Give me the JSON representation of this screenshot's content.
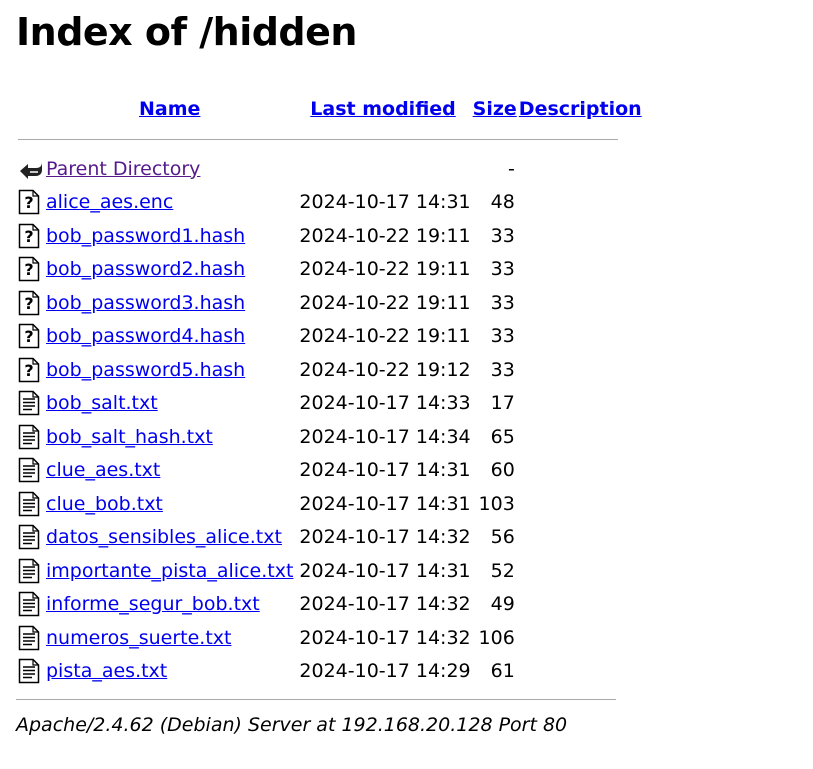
{
  "title": "Index of /hidden",
  "columns": {
    "name": "Name",
    "last_modified": "Last modified",
    "size": "Size",
    "description": "Description"
  },
  "parent": {
    "name": "Parent Directory",
    "size": "-",
    "icon": "back-icon"
  },
  "files": [
    {
      "name": "alice_aes.enc",
      "modified": "2024-10-17 14:31",
      "size": "48",
      "icon": "unknown-file-icon"
    },
    {
      "name": "bob_password1.hash",
      "modified": "2024-10-22 19:11",
      "size": "33",
      "icon": "unknown-file-icon"
    },
    {
      "name": "bob_password2.hash",
      "modified": "2024-10-22 19:11",
      "size": "33",
      "icon": "unknown-file-icon"
    },
    {
      "name": "bob_password3.hash",
      "modified": "2024-10-22 19:11",
      "size": "33",
      "icon": "unknown-file-icon"
    },
    {
      "name": "bob_password4.hash",
      "modified": "2024-10-22 19:11",
      "size": "33",
      "icon": "unknown-file-icon"
    },
    {
      "name": "bob_password5.hash",
      "modified": "2024-10-22 19:12",
      "size": "33",
      "icon": "unknown-file-icon"
    },
    {
      "name": "bob_salt.txt",
      "modified": "2024-10-17 14:33",
      "size": "17",
      "icon": "text-file-icon"
    },
    {
      "name": "bob_salt_hash.txt",
      "modified": "2024-10-17 14:34",
      "size": "65",
      "icon": "text-file-icon"
    },
    {
      "name": "clue_aes.txt",
      "modified": "2024-10-17 14:31",
      "size": "60",
      "icon": "text-file-icon"
    },
    {
      "name": "clue_bob.txt",
      "modified": "2024-10-17 14:31",
      "size": "103",
      "icon": "text-file-icon"
    },
    {
      "name": "datos_sensibles_alice.txt",
      "modified": "2024-10-17 14:32",
      "size": "56",
      "icon": "text-file-icon"
    },
    {
      "name": "importante_pista_alice.txt",
      "modified": "2024-10-17 14:31",
      "size": "52",
      "icon": "text-file-icon"
    },
    {
      "name": "informe_segur_bob.txt",
      "modified": "2024-10-17 14:32",
      "size": "49",
      "icon": "text-file-icon"
    },
    {
      "name": "numeros_suerte.txt",
      "modified": "2024-10-17 14:32",
      "size": "106",
      "icon": "text-file-icon"
    },
    {
      "name": "pista_aes.txt",
      "modified": "2024-10-17 14:29",
      "size": "61",
      "icon": "text-file-icon"
    }
  ],
  "footer": "Apache/2.4.62 (Debian) Server at 192.168.20.128 Port 80",
  "colors": {
    "link": "#0000ee",
    "visited": "#551a8b",
    "rule": "#aaaaaa"
  }
}
